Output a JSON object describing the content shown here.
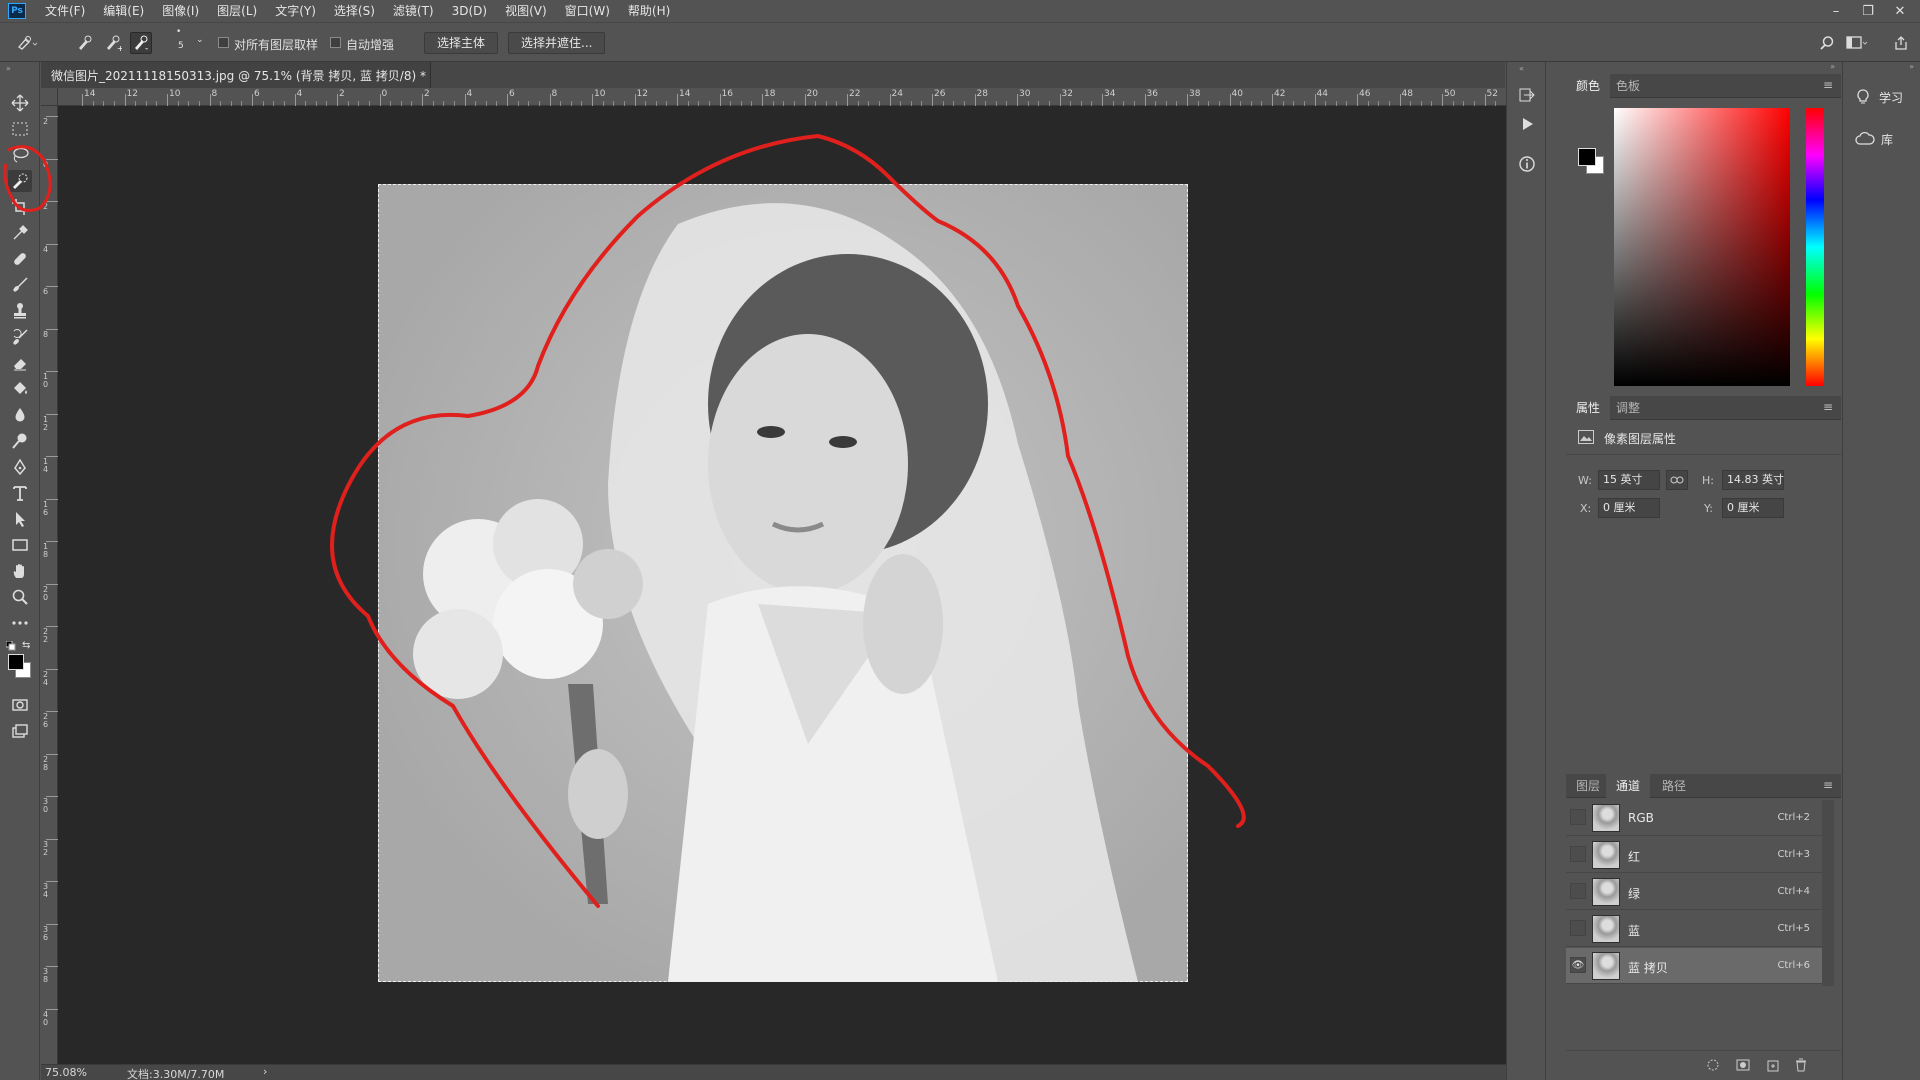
{
  "app": {
    "logo": "Ps"
  },
  "menu": [
    "文件(F)",
    "编辑(E)",
    "图像(I)",
    "图层(L)",
    "文字(Y)",
    "选择(S)",
    "滤镜(T)",
    "3D(D)",
    "视图(V)",
    "窗口(W)",
    "帮助(H)"
  ],
  "window_controls": {
    "minimize": "–",
    "restore": "❐",
    "close": "✕"
  },
  "options": {
    "brush_size": "5",
    "sample_all_layers": "对所有图层取样",
    "auto_enhance": "自动增强",
    "select_subject": "选择主体",
    "select_and_mask": "选择并遮住..."
  },
  "document": {
    "tab_title": "微信图片_20211118150313.jpg @ 75.1% (背景 拷贝, 蓝 拷贝/8) *",
    "close": "×"
  },
  "ruler_h_labels": [
    "14",
    "12",
    "10",
    "8",
    "6",
    "4",
    "2",
    "0",
    "2",
    "4",
    "6",
    "8",
    "10",
    "12",
    "14",
    "16",
    "18",
    "20",
    "22",
    "24",
    "26",
    "28",
    "30",
    "32",
    "34",
    "36",
    "38",
    "40",
    "42",
    "44",
    "46",
    "48",
    "50",
    "52"
  ],
  "ruler_v_labels": [
    "2",
    "0",
    "2",
    "4",
    "6",
    "8",
    "1\n0",
    "1\n2",
    "1\n4",
    "1\n6",
    "1\n8",
    "2\n0",
    "2\n2",
    "2\n4",
    "2\n6",
    "2\n8",
    "3\n0",
    "3\n2",
    "3\n4",
    "3\n6",
    "3\n8",
    "4\n0"
  ],
  "status": {
    "zoom": "75.08%",
    "doc_info": "文档:3.30M/7.70M",
    "arrow": "›"
  },
  "colors": {
    "accent_red": "#e0201c",
    "canvas_bg": "#282828",
    "panel_bg": "#535353"
  },
  "color_panel": {
    "tabs": [
      "颜色",
      "色板"
    ]
  },
  "properties_panel": {
    "tabs": [
      "属性",
      "调整"
    ],
    "header": "像素图层属性",
    "w_label": "W:",
    "w_value": "15 英寸",
    "h_label": "H:",
    "h_value": "14.83 英寸",
    "x_label": "X:",
    "x_value": "0 厘米",
    "y_label": "Y:",
    "y_value": "0 厘米"
  },
  "channels_panel": {
    "tabs": [
      "图层",
      "通道",
      "路径"
    ],
    "rows": [
      {
        "name": "RGB",
        "shortcut": "Ctrl+2",
        "visible": false
      },
      {
        "name": "红",
        "shortcut": "Ctrl+3",
        "visible": false
      },
      {
        "name": "绿",
        "shortcut": "Ctrl+4",
        "visible": false
      },
      {
        "name": "蓝",
        "shortcut": "Ctrl+5",
        "visible": false
      },
      {
        "name": "蓝 拷贝",
        "shortcut": "Ctrl+6",
        "visible": true
      }
    ],
    "eye": "👁"
  },
  "right_dock": {
    "learn": "学习",
    "library": "库"
  }
}
